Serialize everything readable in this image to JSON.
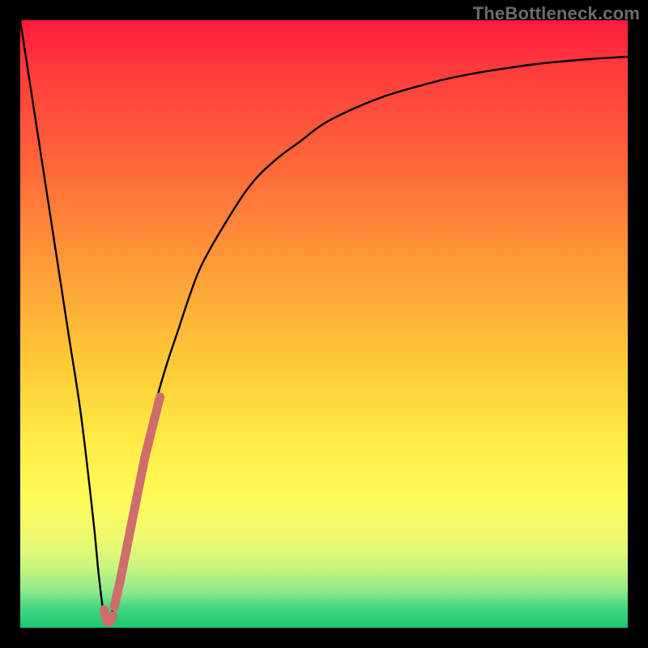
{
  "watermark": "TheBottleneck.com",
  "chart_data": {
    "type": "line",
    "title": "",
    "xlabel": "",
    "ylabel": "",
    "xlim": [
      0,
      100
    ],
    "ylim": [
      0,
      100
    ],
    "series": [
      {
        "name": "bottleneck-curve",
        "color": "#000000",
        "x": [
          0,
          2,
          4,
          6,
          8,
          10,
          12,
          13,
          14,
          15,
          16,
          18,
          20,
          22,
          24,
          26,
          28,
          30,
          34,
          38,
          42,
          46,
          50,
          55,
          60,
          65,
          70,
          75,
          80,
          85,
          90,
          95,
          100
        ],
        "y": [
          100,
          87,
          74,
          61,
          48,
          35,
          18,
          8,
          1,
          2,
          8,
          18,
          28,
          36,
          43,
          49,
          55,
          60,
          67,
          73,
          77,
          80,
          83,
          85.5,
          87.5,
          89,
          90.3,
          91.3,
          92.1,
          92.8,
          93.3,
          93.7,
          94
        ]
      },
      {
        "name": "highlight-segment",
        "color": "#cf6d6d",
        "x": [
          15.5,
          16.5,
          17.5,
          18.5,
          19.5,
          20.5,
          21.5,
          22.5,
          23.0
        ],
        "y": [
          3.5,
          8,
          13,
          18,
          23,
          28,
          32,
          36,
          38
        ]
      },
      {
        "name": "highlight-hook",
        "color": "#cf6d6d",
        "x": [
          13.8,
          14.2,
          14.8,
          15.3
        ],
        "y": [
          3.0,
          1.2,
          1.0,
          2.0
        ]
      }
    ]
  }
}
